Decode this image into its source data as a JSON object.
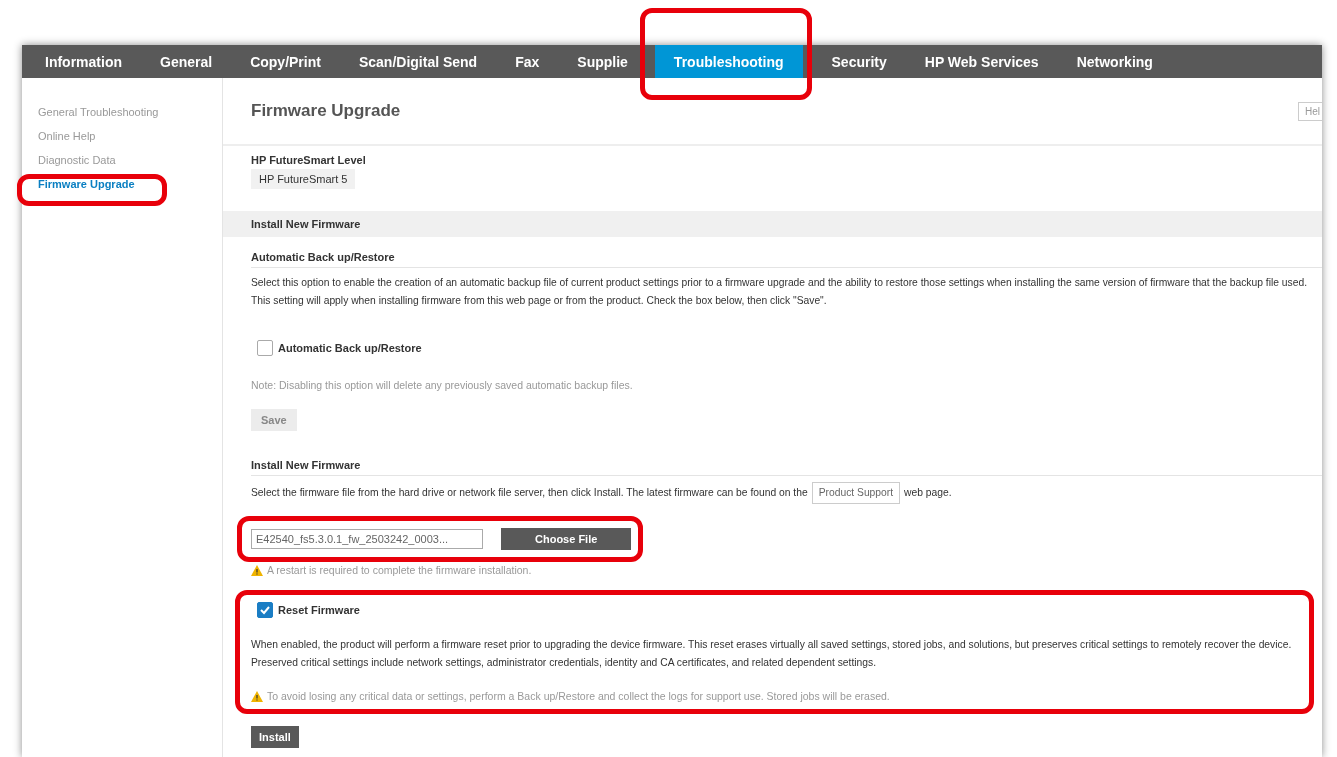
{
  "nav": {
    "tabs": [
      {
        "label": "Information",
        "selected": false
      },
      {
        "label": "General",
        "selected": false
      },
      {
        "label": "Copy/Print",
        "selected": false
      },
      {
        "label": "Scan/Digital Send",
        "selected": false
      },
      {
        "label": "Fax",
        "selected": false
      },
      {
        "label": "Supplie",
        "selected": false
      },
      {
        "label": "Troubleshooting",
        "selected": true
      },
      {
        "label": "Security",
        "selected": false
      },
      {
        "label": "HP Web Services",
        "selected": false
      },
      {
        "label": "Networking",
        "selected": false
      }
    ]
  },
  "sidebar": {
    "items": [
      {
        "label": "General Troubleshooting",
        "selected": false
      },
      {
        "label": "Online Help",
        "selected": false
      },
      {
        "label": "Diagnostic Data",
        "selected": false
      },
      {
        "label": "Firmware Upgrade",
        "selected": true
      }
    ]
  },
  "content": {
    "title": "Firmware Upgrade",
    "help_button": "Hel",
    "futuresmart": {
      "label": "HP FutureSmart Level",
      "value": "HP FutureSmart 5"
    },
    "section_bar": "Install New Firmware",
    "backup": {
      "heading": "Automatic Back up/Restore",
      "description": "Select this option to enable the creation of an automatic backup file of current product settings prior to a firmware upgrade and the ability to restore those settings when installing the same version of firmware that the backup file used. This setting will apply when installing firmware from this web page or from the product. Check the box below, then click \"Save\".",
      "checkbox": {
        "label": "Automatic Back up/Restore",
        "checked": false
      },
      "note": "Note: Disabling this option will delete any previously saved automatic backup files.",
      "save_button": {
        "label": "Save",
        "disabled": true
      }
    },
    "install": {
      "heading": "Install New Firmware",
      "description_before": "Select the firmware file from the hard drive or network file server, then click Install. The latest firmware can be found on the",
      "link": "Product Support",
      "description_after": "web page.",
      "file_value": "E42540_fs5.3.0.1_fw_2503242_0003...",
      "choose_button": "Choose File",
      "restart_warning": "A restart is required to complete the firmware installation.",
      "reset": {
        "label": "Reset Firmware",
        "checked": true
      },
      "reset_description": "When enabled, the product will perform a firmware reset prior to upgrading the device firmware. This reset erases virtually all saved settings, stored jobs, and solutions, but preserves critical settings to remotely recover the device. Preserved critical settings include network settings, administrator credentials, identity and CA certificates, and related dependent settings.",
      "reset_warning": "To avoid losing any critical data or settings, perform a Back up/Restore and collect the logs for support use. Stored jobs will be erased.",
      "install_button": "Install"
    }
  }
}
